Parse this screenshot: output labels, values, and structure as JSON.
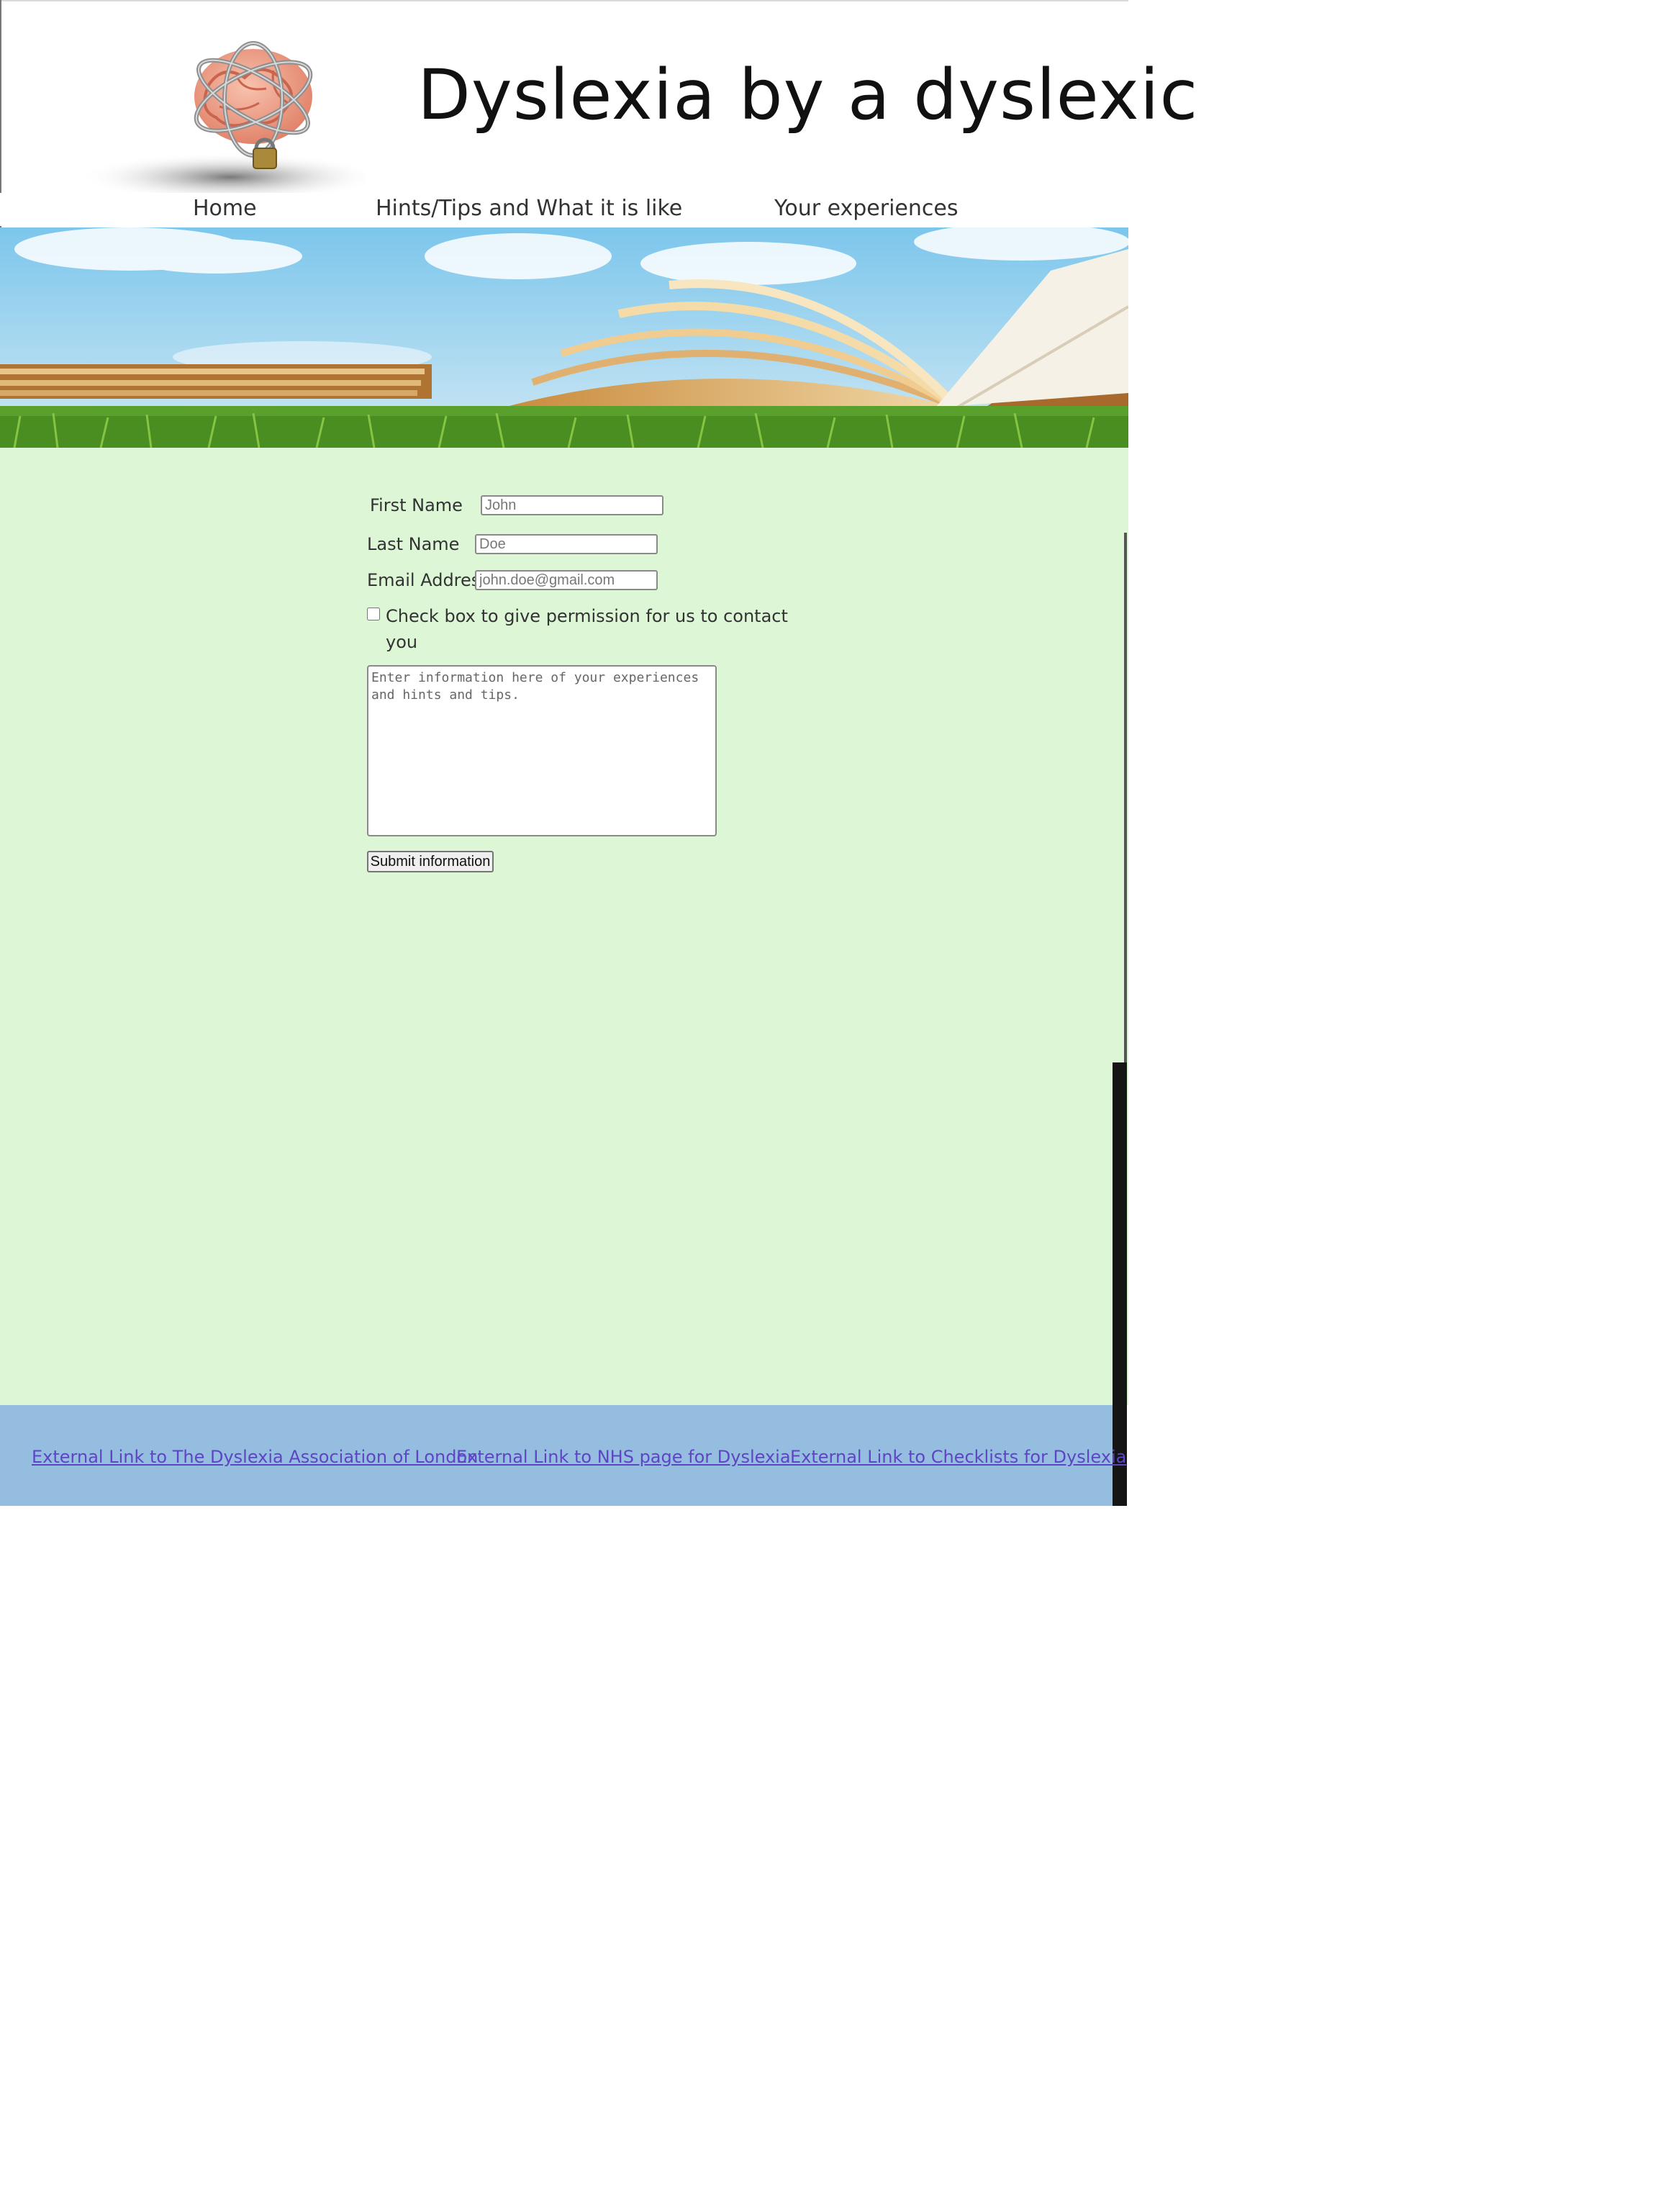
{
  "header": {
    "title": "Dyslexia by a dyslexic",
    "logo_icon": "chained-brain-padlock-icon"
  },
  "nav": {
    "items": [
      {
        "label": "Home"
      },
      {
        "label": "Hints/Tips and What it is like"
      },
      {
        "label": "Your experiences"
      }
    ]
  },
  "banner": {
    "image": "open-book-on-grass-banner"
  },
  "form": {
    "first_name_label": "First Name",
    "first_name_placeholder": "John",
    "last_name_label": "Last Name",
    "last_name_placeholder": "Doe",
    "email_label": "Email Address",
    "email_placeholder": "john.doe@gmail.com",
    "consent_label_line1": "Check box to give permission for us to contact",
    "consent_label_line2": "you",
    "message_placeholder": "Enter information here of your experiences and hints and tips.",
    "submit_label": "Submit information"
  },
  "footer": {
    "links": [
      {
        "label": "External Link to The Dyslexia Association of London"
      },
      {
        "label": "External Link to NHS page for Dyslexia"
      },
      {
        "label": "External Link to Checklists for Dyslexia"
      }
    ]
  },
  "colors": {
    "main_background": "#dcf6d6",
    "footer_background": "#95bde0",
    "link": "#5d45c4"
  }
}
